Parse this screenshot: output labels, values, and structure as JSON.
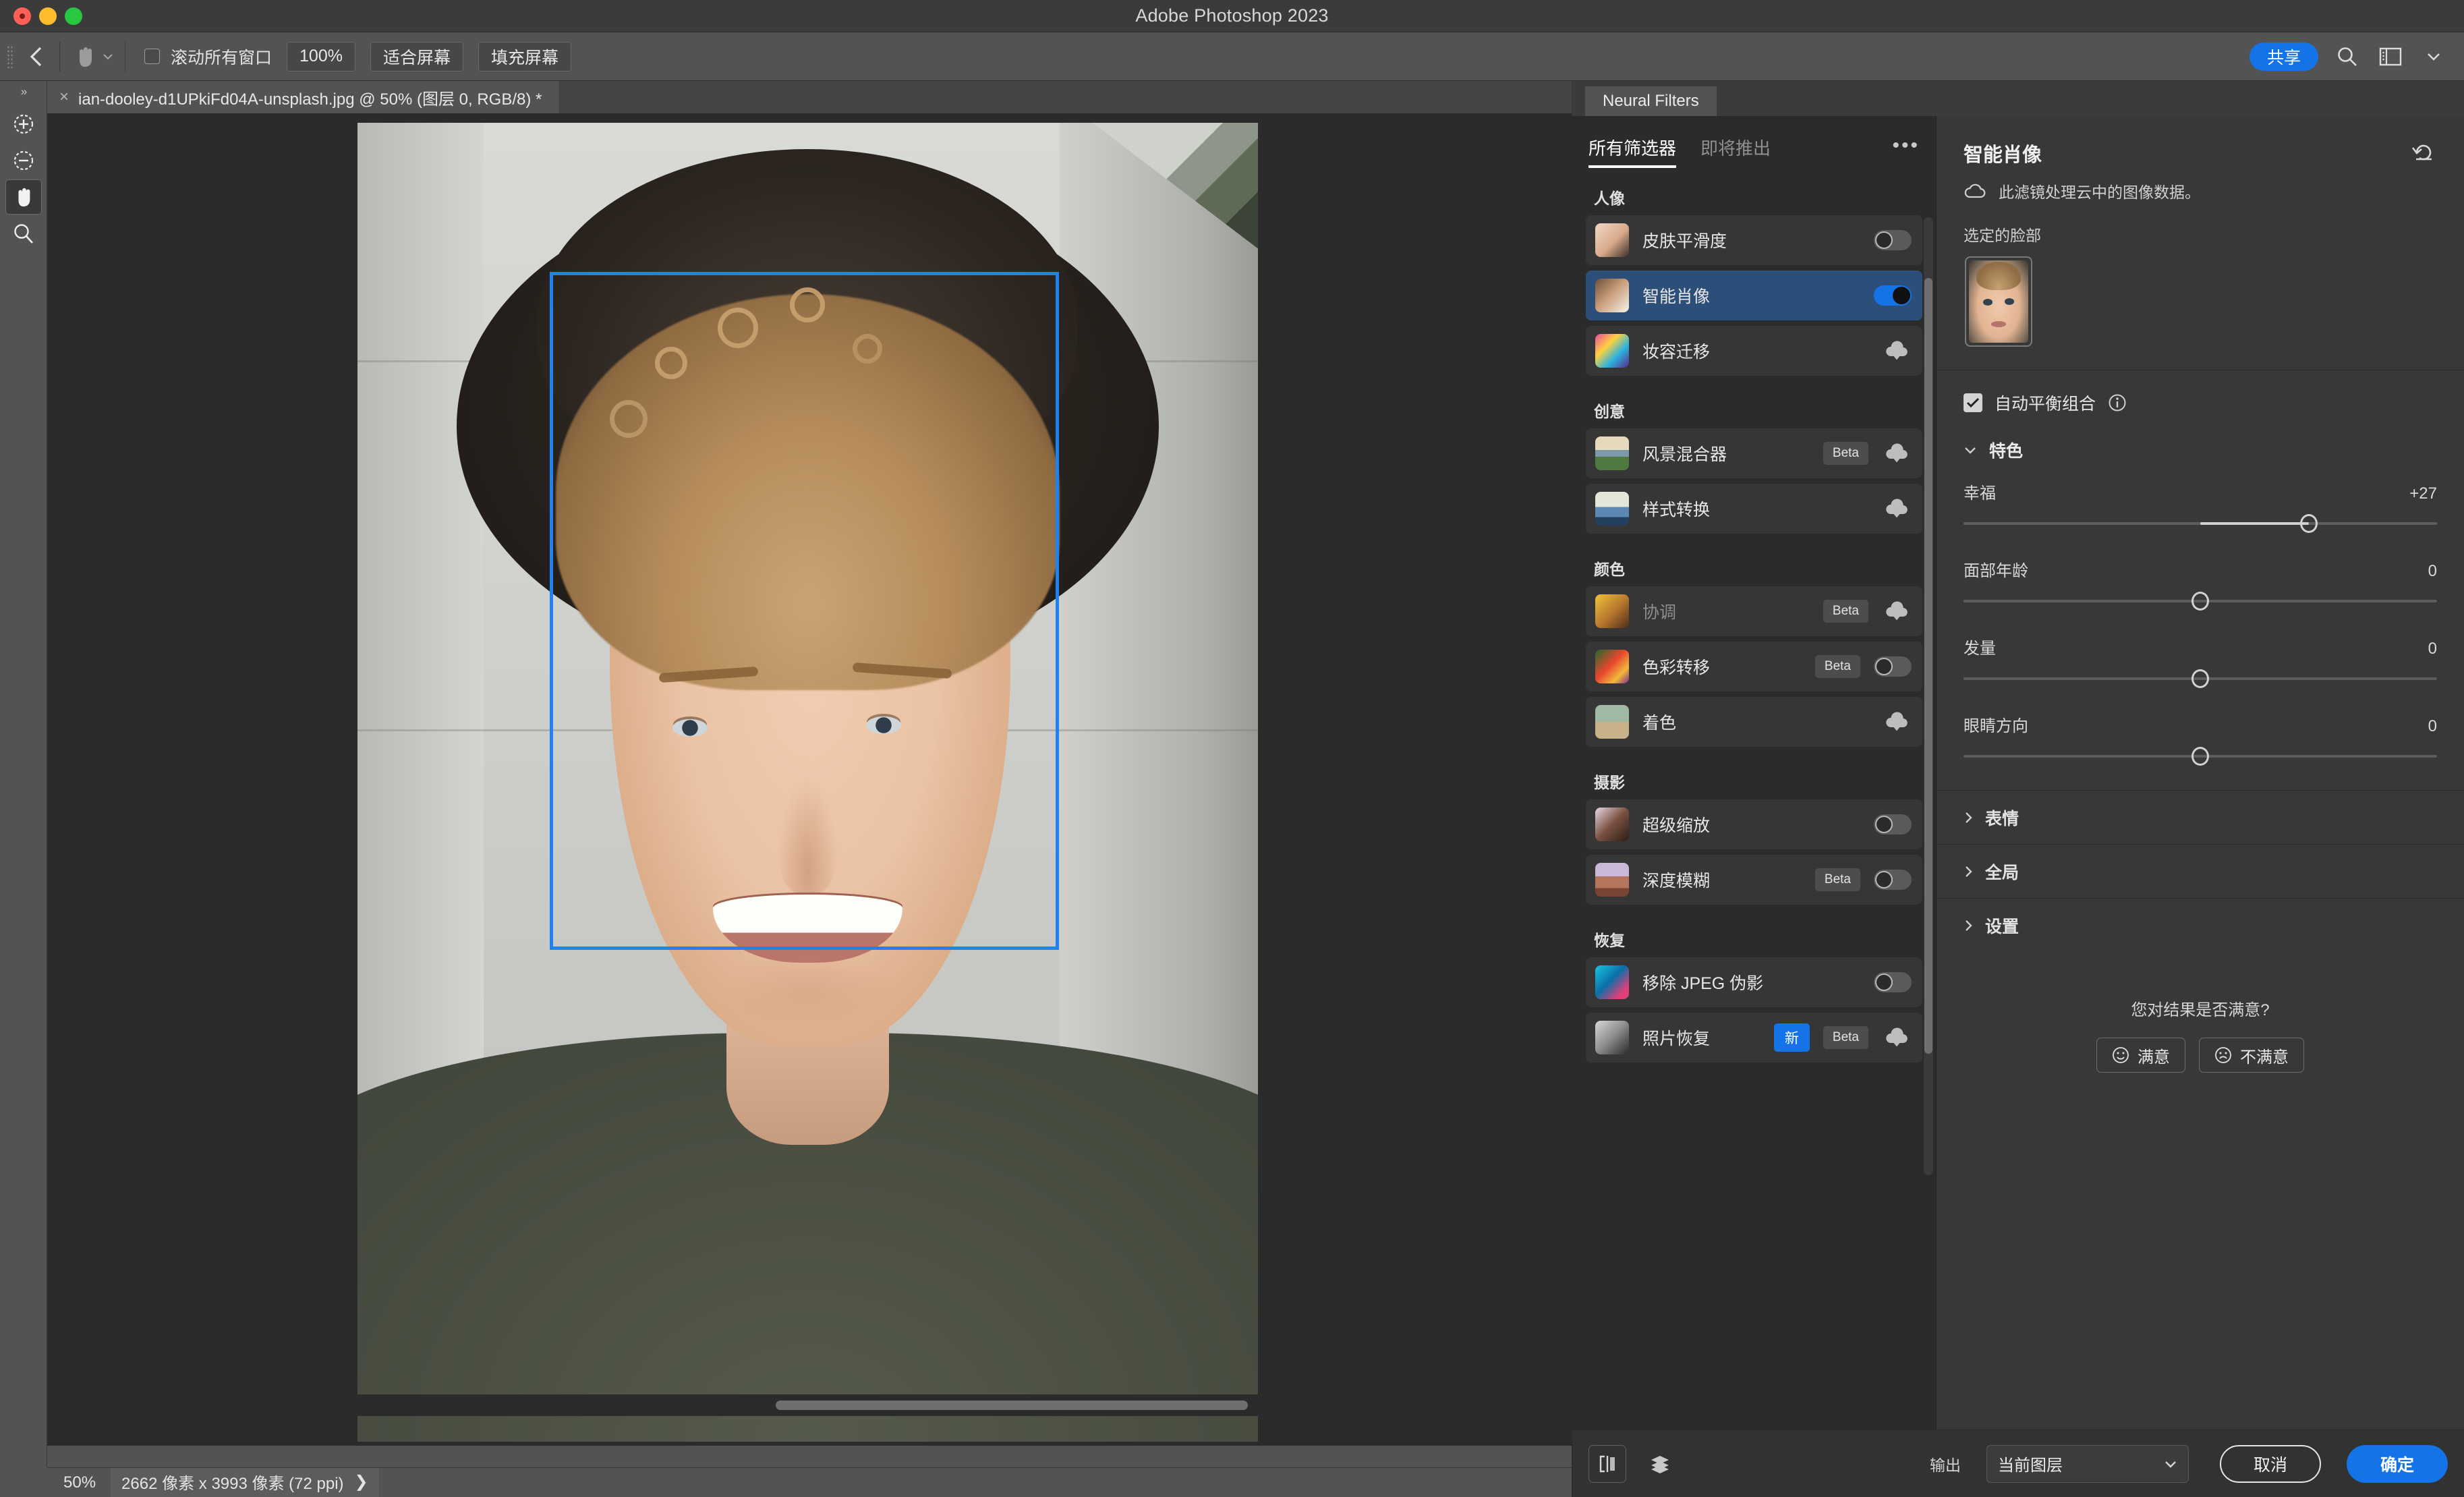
{
  "window": {
    "app_title": "Adobe Photoshop 2023",
    "traffic_lights": [
      "close",
      "minimize",
      "maximize"
    ]
  },
  "options_bar": {
    "back_icon": "back-chevron-icon",
    "tool_icon": "hand-tool-icon",
    "scroll_all_windows_label": "滚动所有窗口",
    "scroll_all_windows_checked": false,
    "zoom_100_label": "100%",
    "fit_screen_label": "适合屏幕",
    "fill_screen_label": "填充屏幕",
    "share_label": "共享",
    "search_icon": "search-icon",
    "workspace_icon": "workspace-icon",
    "chevron_icon": "chevron-down-icon"
  },
  "document_tab": {
    "close_glyph": "×",
    "title": "ian-dooley-d1UPkiFd04A-unsplash.jpg @ 50% (图层 0, RGB/8) *"
  },
  "left_toolbar": {
    "overflow_glyph": "»",
    "items": [
      {
        "name": "zoom-in-tool",
        "icon": "zoom-in-icon",
        "active": false
      },
      {
        "name": "zoom-out-tool",
        "icon": "zoom-out-icon",
        "active": false
      },
      {
        "name": "hand-tool",
        "icon": "hand-icon",
        "active": true
      },
      {
        "name": "zoom-tool",
        "icon": "magnifier-icon",
        "active": false
      }
    ]
  },
  "canvas": {
    "face_selection": "face-bounding-box"
  },
  "status_bar": {
    "zoom": "50%",
    "dimensions": "2662 像素 x 3993 像素 (72 ppi)",
    "expand_glyph": "❯"
  },
  "neural_filters": {
    "panel_tab": "Neural Filters",
    "list": {
      "tabs": [
        {
          "label": "所有筛选器",
          "active": true
        },
        {
          "label": "即将推出",
          "active": false
        }
      ],
      "overflow_glyph": "•••",
      "groups": [
        {
          "title": "人像",
          "filters": [
            {
              "name": "皮肤平滑度",
              "badges": [],
              "control": "toggle",
              "toggle_on": false,
              "selected": false,
              "dim": false,
              "thumb": "skin-smoothing-thumb"
            },
            {
              "name": "智能肖像",
              "badges": [],
              "control": "toggle",
              "toggle_on": true,
              "selected": true,
              "dim": false,
              "thumb": "smart-portrait-thumb"
            },
            {
              "name": "妆容迁移",
              "badges": [],
              "control": "download",
              "toggle_on": false,
              "selected": false,
              "dim": false,
              "thumb": "makeup-transfer-thumb"
            }
          ]
        },
        {
          "title": "创意",
          "filters": [
            {
              "name": "风景混合器",
              "badges": [
                "Beta"
              ],
              "control": "download",
              "toggle_on": false,
              "selected": false,
              "dim": false,
              "thumb": "landscape-mixer-thumb"
            },
            {
              "name": "样式转换",
              "badges": [],
              "control": "download",
              "toggle_on": false,
              "selected": false,
              "dim": false,
              "thumb": "style-transfer-thumb"
            }
          ]
        },
        {
          "title": "颜色",
          "filters": [
            {
              "name": "协调",
              "badges": [
                "Beta"
              ],
              "control": "download",
              "toggle_on": false,
              "selected": false,
              "dim": true,
              "thumb": "harmonization-thumb"
            },
            {
              "name": "色彩转移",
              "badges": [
                "Beta"
              ],
              "control": "toggle",
              "toggle_on": false,
              "selected": false,
              "dim": false,
              "thumb": "color-transfer-thumb"
            },
            {
              "name": "着色",
              "badges": [],
              "control": "download",
              "toggle_on": false,
              "selected": false,
              "dim": false,
              "thumb": "colorize-thumb"
            }
          ]
        },
        {
          "title": "摄影",
          "filters": [
            {
              "name": "超级缩放",
              "badges": [],
              "control": "toggle",
              "toggle_on": false,
              "selected": false,
              "dim": false,
              "thumb": "super-zoom-thumb"
            },
            {
              "name": "深度模糊",
              "badges": [
                "Beta"
              ],
              "control": "toggle",
              "toggle_on": false,
              "selected": false,
              "dim": false,
              "thumb": "depth-blur-thumb"
            }
          ]
        },
        {
          "title": "恢复",
          "filters": [
            {
              "name": "移除 JPEG 伪影",
              "badges": [],
              "control": "toggle",
              "toggle_on": false,
              "selected": false,
              "dim": false,
              "thumb": "jpeg-artifacts-thumb"
            },
            {
              "name": "照片恢复",
              "badges": [
                "新",
                "Beta"
              ],
              "control": "download",
              "toggle_on": false,
              "selected": false,
              "dim": false,
              "thumb": "photo-restoration-thumb"
            }
          ]
        }
      ]
    },
    "properties": {
      "title": "智能肖像",
      "reset_icon": "reset-icon",
      "cloud_icon": "cloud-icon",
      "cloud_note": "此滤镜处理云中的图像数据。",
      "selected_face_label": "选定的脸部",
      "auto_balance": {
        "label": "自动平衡组合",
        "checked": true,
        "info_icon": "info-icon"
      },
      "sections": [
        {
          "title": "特色",
          "expanded": true,
          "sliders": [
            {
              "label": "幸福",
              "value": "+27",
              "position_pct": 73.0,
              "origin_pct": 50
            },
            {
              "label": "面部年龄",
              "value": "0",
              "position_pct": 50,
              "origin_pct": 50
            },
            {
              "label": "发量",
              "value": "0",
              "position_pct": 50,
              "origin_pct": 50
            },
            {
              "label": "眼睛方向",
              "value": "0",
              "position_pct": 50,
              "origin_pct": 50
            }
          ]
        }
      ],
      "collapsed_sections": [
        {
          "title": "表情"
        },
        {
          "title": "全局"
        },
        {
          "title": "设置"
        }
      ],
      "satisfaction": {
        "question": "您对结果是否满意?",
        "positive_label": "满意",
        "positive_icon": "smiley-happy-icon",
        "negative_label": "不满意",
        "negative_icon": "smiley-sad-icon"
      }
    },
    "footer": {
      "preview_compare_icon": "split-preview-icon",
      "layers_icon": "layers-stack-icon",
      "output_label": "输出",
      "output_value": "当前图层",
      "output_chevron": "chevron-down-icon",
      "cancel_label": "取消",
      "ok_label": "确定"
    }
  },
  "colors": {
    "accent_blue": "#1473e6",
    "selection_blue": "#1f82f0",
    "row_selected": "#2c4f7a",
    "panel_bg": "#323232",
    "list_bg": "#2b2b2b",
    "props_bg": "#383838",
    "chrome_bg": "#535353",
    "canvas_bg": "#2b2b2b"
  }
}
